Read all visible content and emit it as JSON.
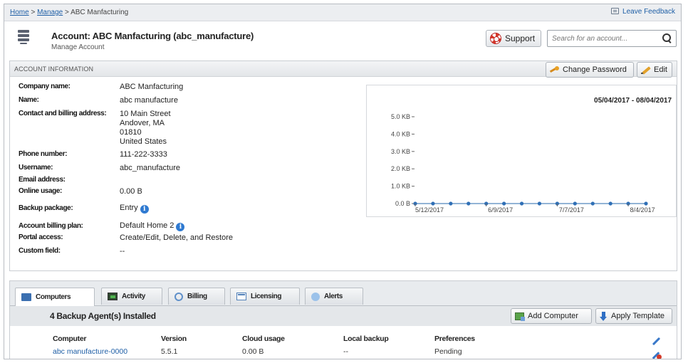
{
  "breadcrumb": {
    "home": "Home",
    "sep1": " > ",
    "manage": "Manage",
    "sep2": " > ",
    "current": "ABC Manfacturing"
  },
  "feedback": {
    "label": "Leave Feedback"
  },
  "header": {
    "title": "Account: ABC Manfacturing (abc_manufacture)",
    "subtitle": "Manage Account"
  },
  "support": {
    "label": "Support"
  },
  "search": {
    "placeholder": "Search for an account...",
    "value": ""
  },
  "account_panel": {
    "title": "ACCOUNT INFORMATION",
    "change_password_label": "Change Password",
    "edit_label": "Edit",
    "fields": {
      "company_name": {
        "label": "Company name:",
        "value": "ABC Manfacturing"
      },
      "name": {
        "label": "Name:",
        "value": "abc manufacture"
      },
      "address": {
        "label": "Contact and billing address:",
        "line1": "10 Main Street",
        "line2": "Andover, MA",
        "line3": "01810",
        "line4": "United States"
      },
      "phone": {
        "label": "Phone number:",
        "value": "111-222-3333"
      },
      "username": {
        "label": "Username:",
        "value": "abc_manufacture"
      },
      "email": {
        "label": "Email address:",
        "value": ""
      },
      "online_usage": {
        "label": "Online usage:",
        "value": "0.00 B"
      },
      "backup_package": {
        "label": "Backup package:",
        "value": "Entry"
      },
      "billing_plan": {
        "label": "Account billing plan:",
        "value": "Default Home 2"
      },
      "portal_access": {
        "label": "Portal access:",
        "value": "Create/Edit, Delete, and Restore"
      },
      "custom_field": {
        "label": "Custom field:",
        "value": "--"
      }
    },
    "info_glyph": "i"
  },
  "chart_data": {
    "type": "line",
    "title": "05/04/2017 - 08/04/2017",
    "xlabel": "",
    "ylabel": "",
    "y_ticks": [
      "5.0 KB",
      "4.0 KB",
      "3.0 KB",
      "2.0 KB",
      "1.0 KB",
      "0.0 B"
    ],
    "y_tick_values": [
      5,
      4,
      3,
      2,
      1,
      0
    ],
    "ylim": [
      0,
      5
    ],
    "x_ticks": [
      "5/12/2017",
      "6/9/2017",
      "7/7/2017",
      "8/4/2017"
    ],
    "x_tick_index": [
      0,
      4,
      8,
      12
    ],
    "series": [
      {
        "values": [
          0,
          0,
          0,
          0,
          0,
          0,
          0,
          0,
          0,
          0,
          0,
          0,
          0,
          0
        ]
      }
    ],
    "points_count": 14,
    "line_color": "#6f9bc9",
    "marker_color": "#2f6fb6",
    "grid": false
  },
  "tabs": [
    {
      "label": "Computers",
      "active": true
    },
    {
      "label": "Activity",
      "active": false
    },
    {
      "label": "Billing",
      "active": false
    },
    {
      "label": "Licensing",
      "active": false
    },
    {
      "label": "Alerts",
      "active": false
    }
  ],
  "computers": {
    "agent_count_label": "4 Backup Agent(s) Installed",
    "add_computer_label": "Add Computer",
    "apply_template_label": "Apply Template",
    "columns": [
      "Computer",
      "Version",
      "Cloud usage",
      "Local backup",
      "Preferences"
    ],
    "rows": [
      {
        "computer": "abc manufacture-0000",
        "version": "5.5.1",
        "cloud_usage": "0.00 B",
        "local_backup": "--",
        "preferences": "Pending"
      }
    ]
  }
}
